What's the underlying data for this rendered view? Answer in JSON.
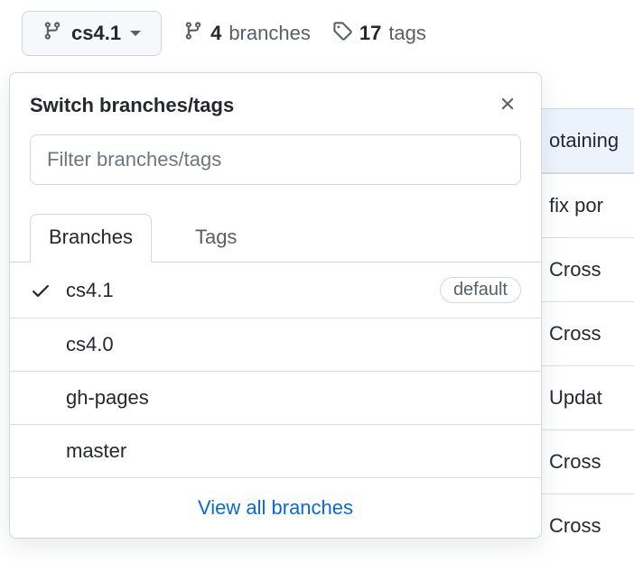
{
  "toolbar": {
    "current_branch": "cs4.1",
    "branches_count": "4",
    "branches_label": "branches",
    "tags_count": "17",
    "tags_label": "tags"
  },
  "popover": {
    "title": "Switch branches/tags",
    "filter_placeholder": "Filter branches/tags",
    "tabs": {
      "branches": "Branches",
      "tags": "Tags"
    },
    "default_badge": "default",
    "view_all": "View all branches",
    "branches": [
      {
        "name": "cs4.1",
        "selected": true,
        "default": true
      },
      {
        "name": "cs4.0",
        "selected": false,
        "default": false
      },
      {
        "name": "gh-pages",
        "selected": false,
        "default": false
      },
      {
        "name": "master",
        "selected": false,
        "default": false
      }
    ]
  },
  "background_rows": [
    {
      "text": "otaining",
      "highlight": true
    },
    {
      "text": "fix por",
      "highlight": false
    },
    {
      "text": "Cross",
      "highlight": false
    },
    {
      "text": "Cross",
      "highlight": false
    },
    {
      "text": "Updat",
      "highlight": false
    },
    {
      "text": "Cross",
      "highlight": false
    },
    {
      "text": "Cross",
      "highlight": false
    }
  ]
}
